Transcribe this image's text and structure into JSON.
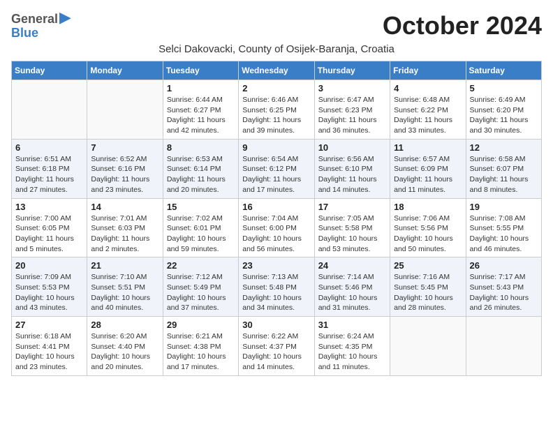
{
  "logo": {
    "general": "General",
    "blue": "Blue"
  },
  "title": "October 2024",
  "subtitle": "Selci Dakovacki, County of Osijek-Baranja, Croatia",
  "weekdays": [
    "Sunday",
    "Monday",
    "Tuesday",
    "Wednesday",
    "Thursday",
    "Friday",
    "Saturday"
  ],
  "weeks": [
    [
      {
        "day": "",
        "info": ""
      },
      {
        "day": "",
        "info": ""
      },
      {
        "day": "1",
        "info": "Sunrise: 6:44 AM\nSunset: 6:27 PM\nDaylight: 11 hours and 42 minutes."
      },
      {
        "day": "2",
        "info": "Sunrise: 6:46 AM\nSunset: 6:25 PM\nDaylight: 11 hours and 39 minutes."
      },
      {
        "day": "3",
        "info": "Sunrise: 6:47 AM\nSunset: 6:23 PM\nDaylight: 11 hours and 36 minutes."
      },
      {
        "day": "4",
        "info": "Sunrise: 6:48 AM\nSunset: 6:22 PM\nDaylight: 11 hours and 33 minutes."
      },
      {
        "day": "5",
        "info": "Sunrise: 6:49 AM\nSunset: 6:20 PM\nDaylight: 11 hours and 30 minutes."
      }
    ],
    [
      {
        "day": "6",
        "info": "Sunrise: 6:51 AM\nSunset: 6:18 PM\nDaylight: 11 hours and 27 minutes."
      },
      {
        "day": "7",
        "info": "Sunrise: 6:52 AM\nSunset: 6:16 PM\nDaylight: 11 hours and 23 minutes."
      },
      {
        "day": "8",
        "info": "Sunrise: 6:53 AM\nSunset: 6:14 PM\nDaylight: 11 hours and 20 minutes."
      },
      {
        "day": "9",
        "info": "Sunrise: 6:54 AM\nSunset: 6:12 PM\nDaylight: 11 hours and 17 minutes."
      },
      {
        "day": "10",
        "info": "Sunrise: 6:56 AM\nSunset: 6:10 PM\nDaylight: 11 hours and 14 minutes."
      },
      {
        "day": "11",
        "info": "Sunrise: 6:57 AM\nSunset: 6:09 PM\nDaylight: 11 hours and 11 minutes."
      },
      {
        "day": "12",
        "info": "Sunrise: 6:58 AM\nSunset: 6:07 PM\nDaylight: 11 hours and 8 minutes."
      }
    ],
    [
      {
        "day": "13",
        "info": "Sunrise: 7:00 AM\nSunset: 6:05 PM\nDaylight: 11 hours and 5 minutes."
      },
      {
        "day": "14",
        "info": "Sunrise: 7:01 AM\nSunset: 6:03 PM\nDaylight: 11 hours and 2 minutes."
      },
      {
        "day": "15",
        "info": "Sunrise: 7:02 AM\nSunset: 6:01 PM\nDaylight: 10 hours and 59 minutes."
      },
      {
        "day": "16",
        "info": "Sunrise: 7:04 AM\nSunset: 6:00 PM\nDaylight: 10 hours and 56 minutes."
      },
      {
        "day": "17",
        "info": "Sunrise: 7:05 AM\nSunset: 5:58 PM\nDaylight: 10 hours and 53 minutes."
      },
      {
        "day": "18",
        "info": "Sunrise: 7:06 AM\nSunset: 5:56 PM\nDaylight: 10 hours and 50 minutes."
      },
      {
        "day": "19",
        "info": "Sunrise: 7:08 AM\nSunset: 5:55 PM\nDaylight: 10 hours and 46 minutes."
      }
    ],
    [
      {
        "day": "20",
        "info": "Sunrise: 7:09 AM\nSunset: 5:53 PM\nDaylight: 10 hours and 43 minutes."
      },
      {
        "day": "21",
        "info": "Sunrise: 7:10 AM\nSunset: 5:51 PM\nDaylight: 10 hours and 40 minutes."
      },
      {
        "day": "22",
        "info": "Sunrise: 7:12 AM\nSunset: 5:49 PM\nDaylight: 10 hours and 37 minutes."
      },
      {
        "day": "23",
        "info": "Sunrise: 7:13 AM\nSunset: 5:48 PM\nDaylight: 10 hours and 34 minutes."
      },
      {
        "day": "24",
        "info": "Sunrise: 7:14 AM\nSunset: 5:46 PM\nDaylight: 10 hours and 31 minutes."
      },
      {
        "day": "25",
        "info": "Sunrise: 7:16 AM\nSunset: 5:45 PM\nDaylight: 10 hours and 28 minutes."
      },
      {
        "day": "26",
        "info": "Sunrise: 7:17 AM\nSunset: 5:43 PM\nDaylight: 10 hours and 26 minutes."
      }
    ],
    [
      {
        "day": "27",
        "info": "Sunrise: 6:18 AM\nSunset: 4:41 PM\nDaylight: 10 hours and 23 minutes."
      },
      {
        "day": "28",
        "info": "Sunrise: 6:20 AM\nSunset: 4:40 PM\nDaylight: 10 hours and 20 minutes."
      },
      {
        "day": "29",
        "info": "Sunrise: 6:21 AM\nSunset: 4:38 PM\nDaylight: 10 hours and 17 minutes."
      },
      {
        "day": "30",
        "info": "Sunrise: 6:22 AM\nSunset: 4:37 PM\nDaylight: 10 hours and 14 minutes."
      },
      {
        "day": "31",
        "info": "Sunrise: 6:24 AM\nSunset: 4:35 PM\nDaylight: 10 hours and 11 minutes."
      },
      {
        "day": "",
        "info": ""
      },
      {
        "day": "",
        "info": ""
      }
    ]
  ]
}
